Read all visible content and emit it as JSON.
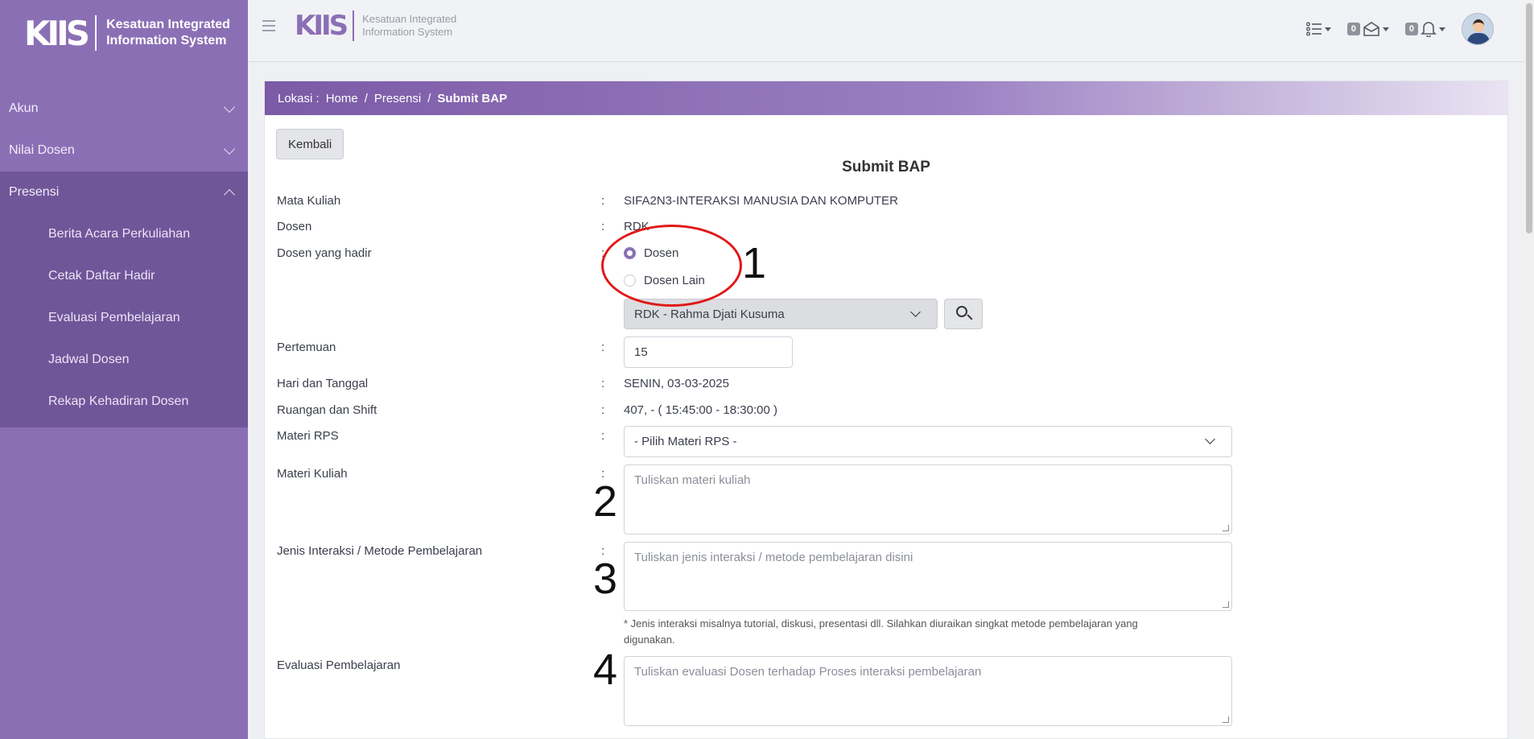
{
  "brand": {
    "mark": "KIIS",
    "line1": "Kesatuan Integrated",
    "line2": "Information System"
  },
  "sidebar": {
    "items": [
      {
        "label": "Akun"
      },
      {
        "label": "Nilai Dosen"
      },
      {
        "label": "Presensi"
      }
    ],
    "presensi_sub": [
      {
        "label": "Berita Acara Perkuliahan"
      },
      {
        "label": "Cetak Daftar Hadir"
      },
      {
        "label": "Evaluasi Pembelajaran"
      },
      {
        "label": "Jadwal Dosen"
      },
      {
        "label": "Rekap Kehadiran Dosen"
      }
    ]
  },
  "topbar": {
    "logo_mark": "KIIS",
    "logo_line1": "Kesatuan Integrated",
    "logo_line2": "Information System",
    "messages_count": "0",
    "notifications_count": "0",
    "list_icon": "list-icon",
    "mail_icon": "envelope-icon",
    "bell_icon": "bell-icon"
  },
  "breadcrumb": {
    "prefix": "Lokasi :",
    "home": "Home",
    "presensi": "Presensi",
    "current": "Submit BAP"
  },
  "form": {
    "back_label": "Kembali",
    "title": "Submit BAP",
    "colon": ":",
    "mata_kuliah_label": "Mata Kuliah",
    "mata_kuliah_value": "SIFA2N3-INTERAKSI MANUSIA DAN KOMPUTER",
    "dosen_label": "Dosen",
    "dosen_value": "RDK",
    "hadir_label": "Dosen yang hadir",
    "radio_dosen": "Dosen",
    "radio_dosen_lain": "Dosen Lain",
    "dosen_select_value": "RDK - Rahma Djati Kusuma",
    "pertemuan_label": "Pertemuan",
    "pertemuan_value": "15",
    "hari_label": "Hari dan Tanggal",
    "hari_value": "SENIN, 03-03-2025",
    "ruangan_label": "Ruangan dan Shift",
    "ruangan_value": "407, - ( 15:45:00 - 18:30:00 )",
    "materi_rps_label": "Materi RPS",
    "materi_rps_value": "- Pilih Materi RPS -",
    "materi_kuliah_label": "Materi Kuliah",
    "materi_kuliah_placeholder": "Tuliskan materi kuliah",
    "interaksi_label": "Jenis Interaksi / Metode Pembelajaran",
    "interaksi_placeholder": "Tuliskan jenis interaksi / metode pembelajaran disini",
    "interaksi_hint": "* Jenis interaksi misalnya tutorial, diskusi, presentasi dll. Silahkan diuraikan singkat metode pembelajaran yang digunakan.",
    "evaluasi_label": "Evaluasi Pembelajaran",
    "evaluasi_placeholder": "Tuliskan evaluasi Dosen terhadap Proses interaksi pembelajaran"
  },
  "annotations": {
    "n1": "1",
    "n2": "2",
    "n3": "3",
    "n4": "4",
    "ring_color": "#e01818"
  },
  "colors": {
    "sidebar": "#8b6fb5",
    "sidebar_active": "#6f5699",
    "accent": "#8b6fb5"
  }
}
